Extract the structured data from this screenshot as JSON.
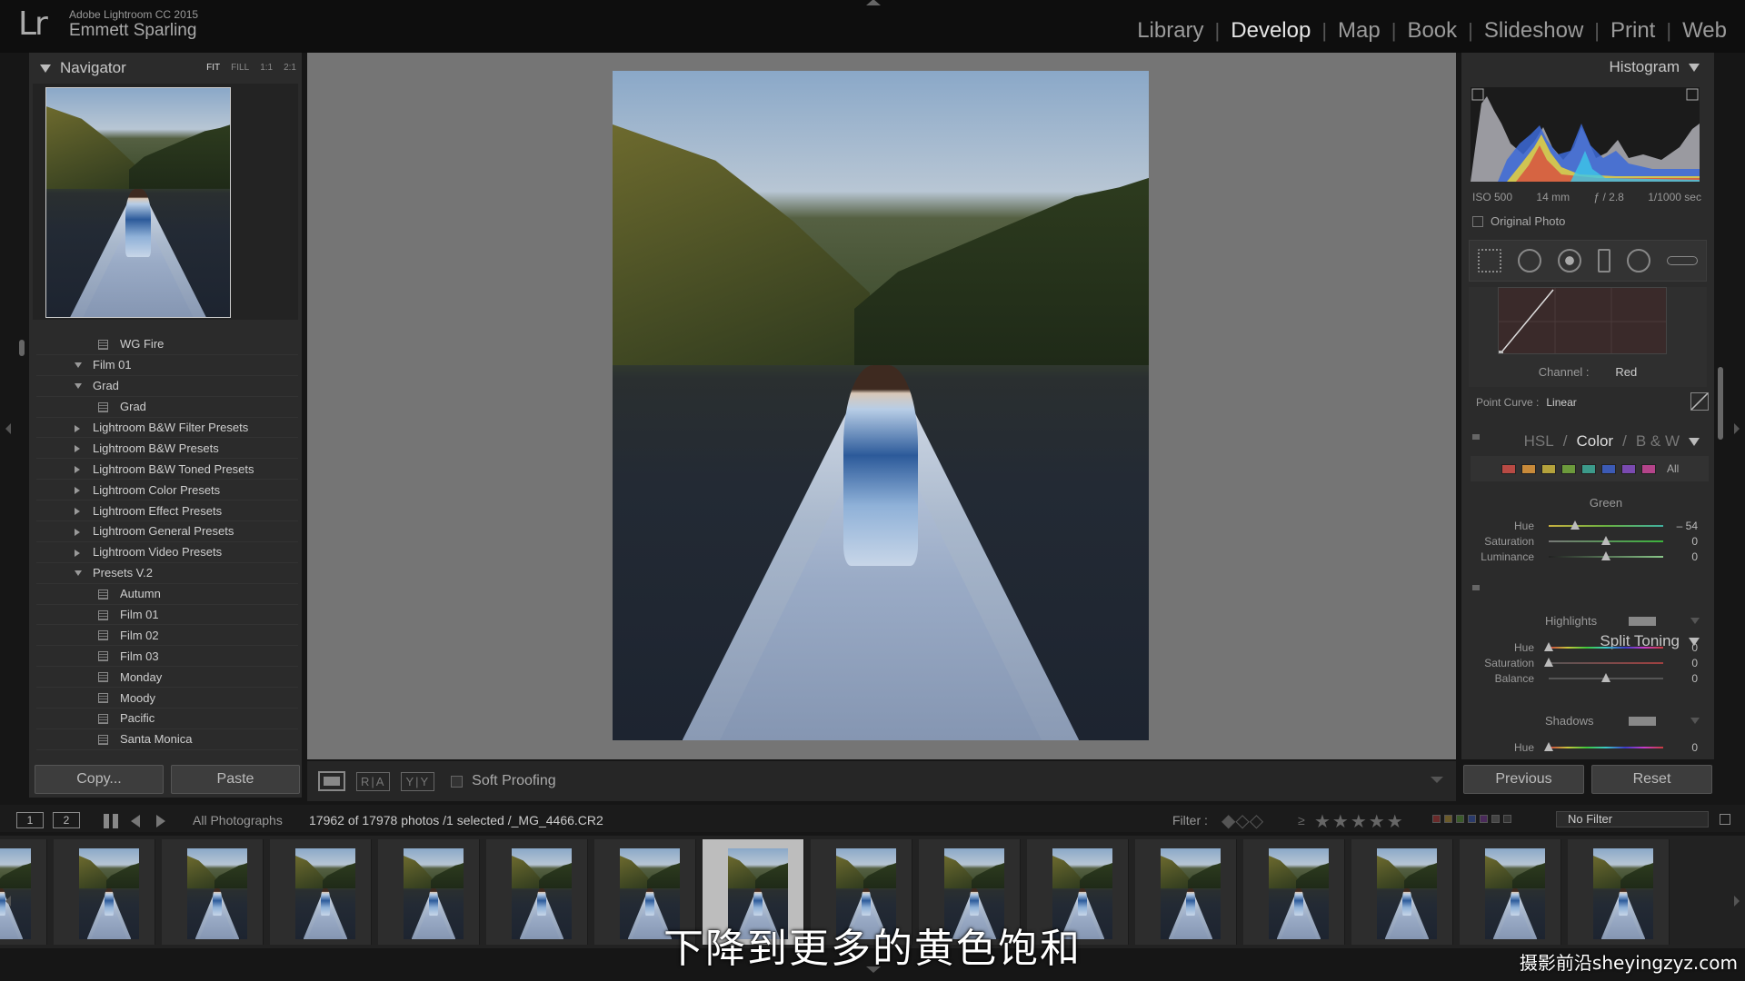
{
  "app": {
    "logo": "Lr",
    "product": "Adobe Lightroom CC 2015",
    "user": "Emmett Sparling"
  },
  "modules": [
    "Library",
    "Develop",
    "Map",
    "Book",
    "Slideshow",
    "Print",
    "Web"
  ],
  "active_module": "Develop",
  "navigator": {
    "title": "Navigator",
    "zoom": [
      "FIT",
      "FILL",
      "1:1",
      "2:1"
    ],
    "active_zoom": "FIT"
  },
  "presets": [
    {
      "label": "WG Fire",
      "kind": "item"
    },
    {
      "label": "Film 01",
      "kind": "folder",
      "open": true
    },
    {
      "label": "Grad",
      "kind": "folder",
      "open": true
    },
    {
      "label": "Grad",
      "kind": "item"
    },
    {
      "label": "Lightroom B&W Filter Presets",
      "kind": "folder",
      "open": false
    },
    {
      "label": "Lightroom B&W Presets",
      "kind": "folder",
      "open": false
    },
    {
      "label": "Lightroom B&W Toned Presets",
      "kind": "folder",
      "open": false
    },
    {
      "label": "Lightroom Color Presets",
      "kind": "folder",
      "open": false
    },
    {
      "label": "Lightroom Effect Presets",
      "kind": "folder",
      "open": false
    },
    {
      "label": "Lightroom General Presets",
      "kind": "folder",
      "open": false
    },
    {
      "label": "Lightroom Video Presets",
      "kind": "folder",
      "open": false
    },
    {
      "label": "Presets V.2",
      "kind": "folder",
      "open": true
    },
    {
      "label": "Autumn",
      "kind": "item"
    },
    {
      "label": "Film 01",
      "kind": "item"
    },
    {
      "label": "Film 02",
      "kind": "item"
    },
    {
      "label": "Film 03",
      "kind": "item"
    },
    {
      "label": "Monday",
      "kind": "item"
    },
    {
      "label": "Moody",
      "kind": "item"
    },
    {
      "label": "Pacific",
      "kind": "item"
    },
    {
      "label": "Santa Monica",
      "kind": "item"
    }
  ],
  "left_buttons": {
    "copy": "Copy...",
    "paste": "Paste"
  },
  "toolbar": {
    "ry1": "R|A",
    "ry2": "Y|Y",
    "soft_proofing": "Soft Proofing"
  },
  "histogram": {
    "title": "Histogram",
    "iso": "ISO 500",
    "focal": "14 mm",
    "aperture": "ƒ / 2.8",
    "shutter": "1/1000 sec",
    "original_photo": "Original Photo"
  },
  "tone_curve": {
    "channel_label": "Channel :",
    "channel_value": "Red",
    "point_curve_label": "Point Curve :",
    "point_curve_value": "Linear"
  },
  "hsl": {
    "tabs": [
      "HSL",
      "Color",
      "B & W"
    ],
    "active_tab": "Color",
    "swatch_colors": [
      "#b84a44",
      "#c88a3a",
      "#b4a23c",
      "#6c9a3c",
      "#3c9a8a",
      "#3c5ab4",
      "#7a4ab0",
      "#b4448a"
    ],
    "all_label": "All",
    "selected_color": "Green",
    "sliders": [
      {
        "label": "Hue",
        "value": "– 54",
        "position": 0.23
      },
      {
        "label": "Saturation",
        "value": "0",
        "position": 0.5
      },
      {
        "label": "Luminance",
        "value": "0",
        "position": 0.5
      }
    ]
  },
  "split_toning": {
    "title": "Split Toning",
    "highlights_label": "Highlights",
    "highlights": [
      {
        "label": "Hue",
        "value": "0",
        "position": 0
      },
      {
        "label": "Saturation",
        "value": "0",
        "position": 0
      }
    ],
    "balance": {
      "label": "Balance",
      "value": "0",
      "position": 0.5
    },
    "shadows_label": "Shadows",
    "shadows": [
      {
        "label": "Hue",
        "value": "0",
        "position": 0
      }
    ]
  },
  "right_buttons": {
    "previous": "Previous",
    "reset": "Reset"
  },
  "filmbar": {
    "view1": "1",
    "view2": "2",
    "source": "All Photographs",
    "count": "17962 of 17978 photos /1 selected /_MG_4466.CR2",
    "filter_label": "Filter :",
    "rating_op": "≥",
    "filter_value": "No Filter"
  },
  "filmstrip": {
    "count": 16,
    "selected_index": 7
  },
  "subtitle": "下降到更多的黄色饱和",
  "watermark": "摄影前沿sheyingzyz.com"
}
